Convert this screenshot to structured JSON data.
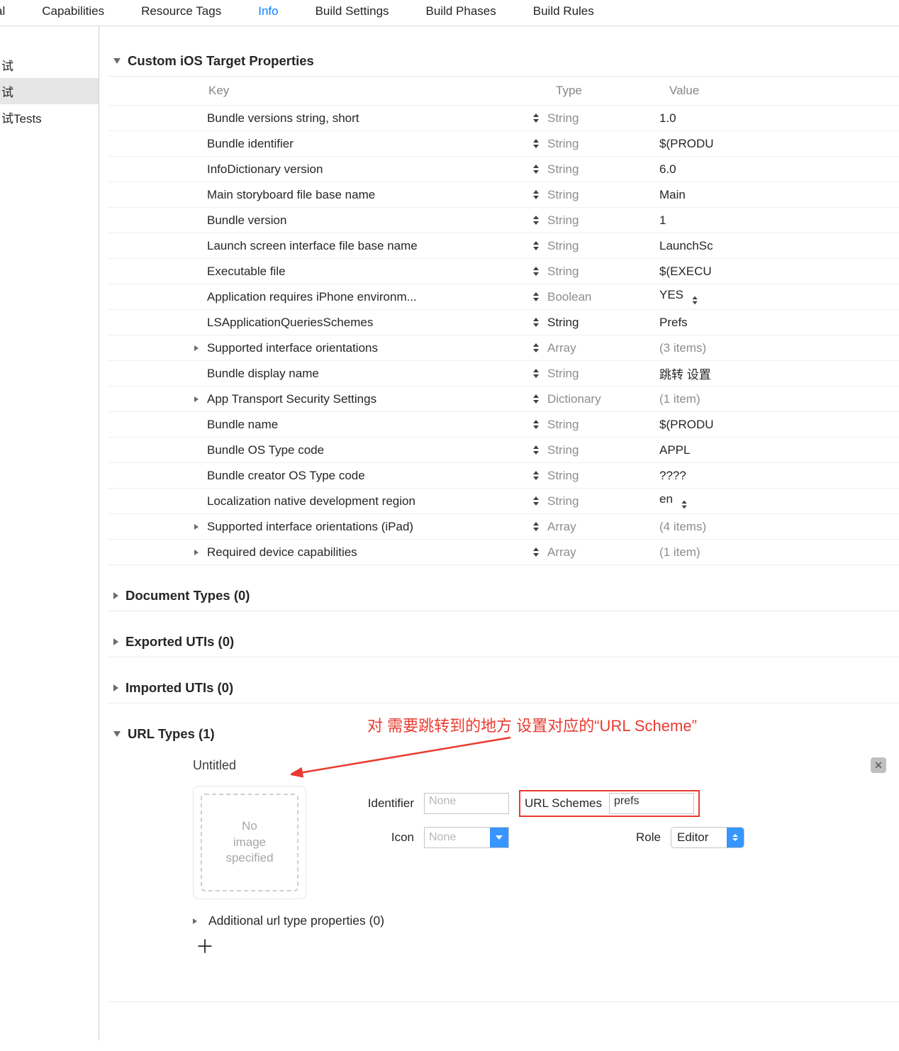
{
  "tabs": [
    "al",
    "Capabilities",
    "Resource Tags",
    "Info",
    "Build Settings",
    "Build Phases",
    "Build Rules"
  ],
  "active_tab": "Info",
  "sidebar": {
    "items": [
      "试",
      "试",
      "试Tests"
    ],
    "selected_index": 1
  },
  "section": {
    "properties_title": "Custom iOS Target Properties",
    "doc_types": "Document Types (0)",
    "exported": "Exported UTIs (0)",
    "imported": "Imported UTIs (0)",
    "url_types": "URL Types (1)",
    "additional": "Additional url type properties (0)"
  },
  "headers": {
    "key": "Key",
    "type": "Type",
    "value": "Value"
  },
  "rows": [
    {
      "chev": false,
      "key": "Bundle versions string, short",
      "type": "String",
      "tdim": true,
      "val": "1.0",
      "vdim": false,
      "vstep": false
    },
    {
      "chev": false,
      "key": "Bundle identifier",
      "type": "String",
      "tdim": true,
      "val": "$(PRODU",
      "vdim": false,
      "vstep": false
    },
    {
      "chev": false,
      "key": "InfoDictionary version",
      "type": "String",
      "tdim": true,
      "val": "6.0",
      "vdim": false,
      "vstep": false
    },
    {
      "chev": false,
      "key": "Main storyboard file base name",
      "type": "String",
      "tdim": true,
      "val": "Main",
      "vdim": false,
      "vstep": false
    },
    {
      "chev": false,
      "key": "Bundle version",
      "type": "String",
      "tdim": true,
      "val": "1",
      "vdim": false,
      "vstep": false
    },
    {
      "chev": false,
      "key": "Launch screen interface file base name",
      "type": "String",
      "tdim": true,
      "val": "LaunchSc",
      "vdim": false,
      "vstep": false
    },
    {
      "chev": false,
      "key": "Executable file",
      "type": "String",
      "tdim": true,
      "val": "$(EXECU",
      "vdim": false,
      "vstep": false
    },
    {
      "chev": false,
      "key": "Application requires iPhone environm...",
      "type": "Boolean",
      "tdim": true,
      "val": "YES",
      "vdim": false,
      "vstep": true
    },
    {
      "chev": false,
      "key": "LSApplicationQueriesSchemes",
      "type": "String",
      "tdim": false,
      "val": "Prefs",
      "vdim": false,
      "vstep": false
    },
    {
      "chev": true,
      "key": "Supported interface orientations",
      "type": "Array",
      "tdim": true,
      "val": "(3 items)",
      "vdim": true,
      "vstep": false
    },
    {
      "chev": false,
      "key": "Bundle display name",
      "type": "String",
      "tdim": true,
      "val": "跳转 设置",
      "vdim": false,
      "vstep": false
    },
    {
      "chev": true,
      "key": "App Transport Security Settings",
      "type": "Dictionary",
      "tdim": true,
      "val": "(1 item)",
      "vdim": true,
      "vstep": false
    },
    {
      "chev": false,
      "key": "Bundle name",
      "type": "String",
      "tdim": true,
      "val": "$(PRODU",
      "vdim": false,
      "vstep": false
    },
    {
      "chev": false,
      "key": "Bundle OS Type code",
      "type": "String",
      "tdim": true,
      "val": "APPL",
      "vdim": false,
      "vstep": false
    },
    {
      "chev": false,
      "key": "Bundle creator OS Type code",
      "type": "String",
      "tdim": true,
      "val": "????",
      "vdim": false,
      "vstep": false
    },
    {
      "chev": false,
      "key": "Localization native development region",
      "type": "String",
      "tdim": true,
      "val": "en",
      "vdim": false,
      "vstep": true
    },
    {
      "chev": true,
      "key": "Supported interface orientations (iPad)",
      "type": "Array",
      "tdim": true,
      "val": "(4 items)",
      "vdim": true,
      "vstep": false
    },
    {
      "chev": true,
      "key": "Required device capabilities",
      "type": "Array",
      "tdim": true,
      "val": "(1 item)",
      "vdim": true,
      "vstep": false
    }
  ],
  "url": {
    "untitled": "Untitled",
    "image_well": "No\nimage\nspecified",
    "identifier_label": "Identifier",
    "identifier_placeholder": "None",
    "schemes_label": "URL Schemes",
    "schemes_value": "prefs",
    "icon_label": "Icon",
    "icon_placeholder": "None",
    "role_label": "Role",
    "role_value": "Editor"
  },
  "annotation": "对 需要跳转到的地方 设置对应的“URL Scheme”"
}
